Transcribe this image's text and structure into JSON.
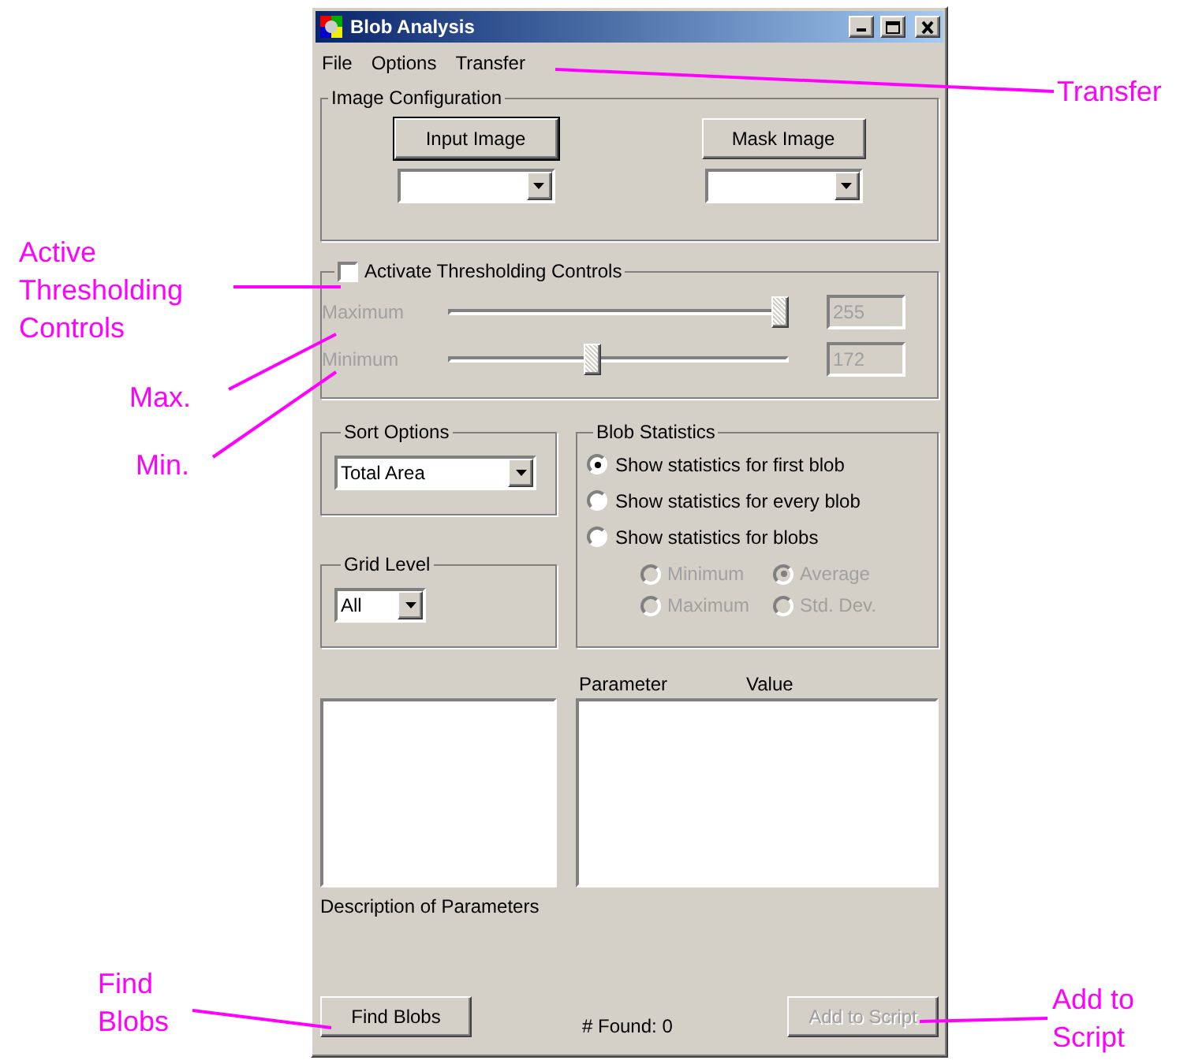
{
  "window": {
    "title": "Blob Analysis"
  },
  "menu": [
    "File",
    "Options",
    "Transfer"
  ],
  "image_configuration": {
    "title": "Image Configuration",
    "buttons": [
      {
        "label": "Input Image",
        "focused": true
      },
      {
        "label": "Mask Image",
        "focused": false
      }
    ]
  },
  "thresholding": {
    "label": "Activate Thresholding Controls",
    "checked": false,
    "sliders": [
      {
        "label": "Maximum",
        "level": 1.0,
        "reading": "255"
      },
      {
        "label": "Minimum",
        "level": 0.42,
        "reading": "172"
      }
    ]
  },
  "sort_options": {
    "title": "Sort Options",
    "value": "Total Area"
  },
  "grid_level": {
    "title": "Grid Level",
    "value": "All"
  },
  "blob_statistics": {
    "title": "Blob Statistics",
    "options": [
      {
        "label": "Show statistics for first blob",
        "selected": true
      },
      {
        "label": "Show statistics for every blob",
        "selected": false
      },
      {
        "label": "Show statistics for blobs",
        "selected": false
      }
    ],
    "sub_options": [
      {
        "label": "Minimum",
        "selected": false
      },
      {
        "label": "Average",
        "selected": true
      },
      {
        "label": "Maximum",
        "selected": false
      },
      {
        "label": "Std. Dev.",
        "selected": false
      }
    ]
  },
  "parameter_list": {
    "columns": [
      "Parameter",
      "Value"
    ]
  },
  "description_label": "Description of Parameters",
  "footer": {
    "find_button": "Find Blobs",
    "found": "# Found: 0",
    "add_button": {
      "label": "Add to Script",
      "disabled": true
    }
  },
  "annotations": [
    "Transfer",
    "Active Thresholding Controls",
    "Max.",
    "Min.",
    "Find Blobs",
    "Add to Script"
  ]
}
